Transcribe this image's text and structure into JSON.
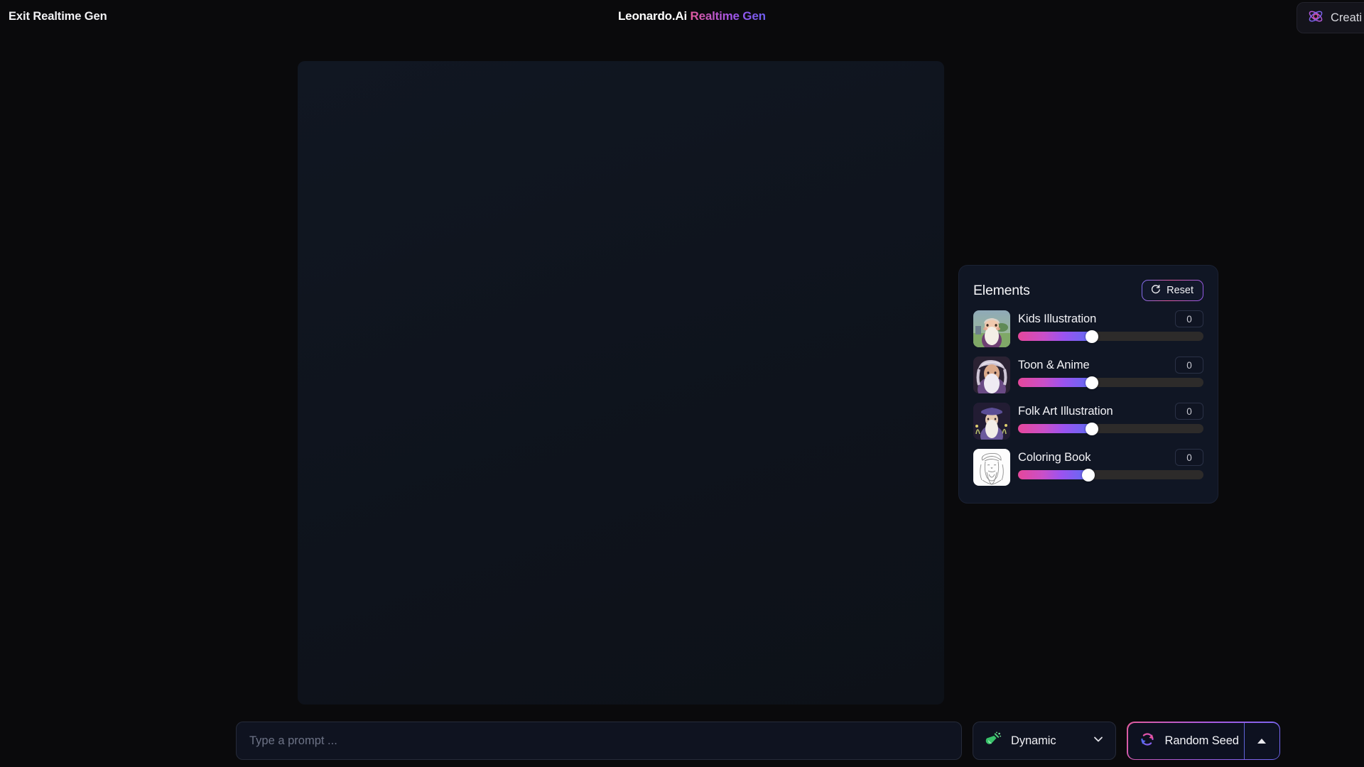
{
  "header": {
    "exit_label": "Exit Realtime Gen",
    "brand_name": "Leonardo.Ai",
    "brand_suffix": "Realtime Gen",
    "creative_label": "Creati",
    "creative_icon": "atom-orbit-icon",
    "brand_gradient_from": "#e15a9e",
    "brand_gradient_to": "#6e5ef0"
  },
  "canvas": {
    "state": "empty",
    "background": "#0f141c"
  },
  "elements_panel": {
    "title": "Elements",
    "reset_label": "Reset",
    "reset_icon": "rotate-counterclockwise-icon",
    "items": [
      {
        "label": "Kids Illustration",
        "value": "0",
        "slider_percent": 40,
        "thumbnail": "wizard-kids-illustration-thumbnail"
      },
      {
        "label": "Toon & Anime",
        "value": "0",
        "slider_percent": 40,
        "thumbnail": "wizard-toon-anime-thumbnail"
      },
      {
        "label": "Folk Art Illustration",
        "value": "0",
        "slider_percent": 40,
        "thumbnail": "wizard-folk-art-thumbnail"
      },
      {
        "label": "Coloring Book",
        "value": "0",
        "slider_percent": 38,
        "thumbnail": "wizard-coloring-book-thumbnail"
      }
    ],
    "slider_gradient": [
      "#e5479b",
      "#9b53f0",
      "#5f6cf2"
    ],
    "slider_track_color": "#2d2b2a"
  },
  "bottom_bar": {
    "prompt_placeholder": "Type a prompt ...",
    "prompt_value": "",
    "preset_label": "Dynamic",
    "preset_icon": "green-potion-flask-icon",
    "preset_chevron_icon": "chevron-down-icon",
    "seed_label": "Random Seed",
    "seed_icon": "circular-arrows-refresh-icon",
    "seed_expand_icon": "caret-up-icon",
    "seed_gradient_from": "#e05b9c",
    "seed_gradient_to": "#6d68f2"
  }
}
